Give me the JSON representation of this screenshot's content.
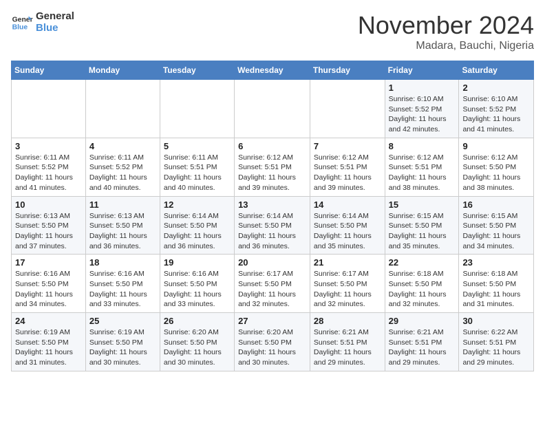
{
  "header": {
    "logo_line1": "General",
    "logo_line2": "Blue",
    "month": "November 2024",
    "location": "Madara, Bauchi, Nigeria"
  },
  "weekdays": [
    "Sunday",
    "Monday",
    "Tuesday",
    "Wednesday",
    "Thursday",
    "Friday",
    "Saturday"
  ],
  "weeks": [
    [
      {
        "day": "",
        "info": ""
      },
      {
        "day": "",
        "info": ""
      },
      {
        "day": "",
        "info": ""
      },
      {
        "day": "",
        "info": ""
      },
      {
        "day": "",
        "info": ""
      },
      {
        "day": "1",
        "info": "Sunrise: 6:10 AM\nSunset: 5:52 PM\nDaylight: 11 hours\nand 42 minutes."
      },
      {
        "day": "2",
        "info": "Sunrise: 6:10 AM\nSunset: 5:52 PM\nDaylight: 11 hours\nand 41 minutes."
      }
    ],
    [
      {
        "day": "3",
        "info": "Sunrise: 6:11 AM\nSunset: 5:52 PM\nDaylight: 11 hours\nand 41 minutes."
      },
      {
        "day": "4",
        "info": "Sunrise: 6:11 AM\nSunset: 5:52 PM\nDaylight: 11 hours\nand 40 minutes."
      },
      {
        "day": "5",
        "info": "Sunrise: 6:11 AM\nSunset: 5:51 PM\nDaylight: 11 hours\nand 40 minutes."
      },
      {
        "day": "6",
        "info": "Sunrise: 6:12 AM\nSunset: 5:51 PM\nDaylight: 11 hours\nand 39 minutes."
      },
      {
        "day": "7",
        "info": "Sunrise: 6:12 AM\nSunset: 5:51 PM\nDaylight: 11 hours\nand 39 minutes."
      },
      {
        "day": "8",
        "info": "Sunrise: 6:12 AM\nSunset: 5:51 PM\nDaylight: 11 hours\nand 38 minutes."
      },
      {
        "day": "9",
        "info": "Sunrise: 6:12 AM\nSunset: 5:50 PM\nDaylight: 11 hours\nand 38 minutes."
      }
    ],
    [
      {
        "day": "10",
        "info": "Sunrise: 6:13 AM\nSunset: 5:50 PM\nDaylight: 11 hours\nand 37 minutes."
      },
      {
        "day": "11",
        "info": "Sunrise: 6:13 AM\nSunset: 5:50 PM\nDaylight: 11 hours\nand 36 minutes."
      },
      {
        "day": "12",
        "info": "Sunrise: 6:14 AM\nSunset: 5:50 PM\nDaylight: 11 hours\nand 36 minutes."
      },
      {
        "day": "13",
        "info": "Sunrise: 6:14 AM\nSunset: 5:50 PM\nDaylight: 11 hours\nand 36 minutes."
      },
      {
        "day": "14",
        "info": "Sunrise: 6:14 AM\nSunset: 5:50 PM\nDaylight: 11 hours\nand 35 minutes."
      },
      {
        "day": "15",
        "info": "Sunrise: 6:15 AM\nSunset: 5:50 PM\nDaylight: 11 hours\nand 35 minutes."
      },
      {
        "day": "16",
        "info": "Sunrise: 6:15 AM\nSunset: 5:50 PM\nDaylight: 11 hours\nand 34 minutes."
      }
    ],
    [
      {
        "day": "17",
        "info": "Sunrise: 6:16 AM\nSunset: 5:50 PM\nDaylight: 11 hours\nand 34 minutes."
      },
      {
        "day": "18",
        "info": "Sunrise: 6:16 AM\nSunset: 5:50 PM\nDaylight: 11 hours\nand 33 minutes."
      },
      {
        "day": "19",
        "info": "Sunrise: 6:16 AM\nSunset: 5:50 PM\nDaylight: 11 hours\nand 33 minutes."
      },
      {
        "day": "20",
        "info": "Sunrise: 6:17 AM\nSunset: 5:50 PM\nDaylight: 11 hours\nand 32 minutes."
      },
      {
        "day": "21",
        "info": "Sunrise: 6:17 AM\nSunset: 5:50 PM\nDaylight: 11 hours\nand 32 minutes."
      },
      {
        "day": "22",
        "info": "Sunrise: 6:18 AM\nSunset: 5:50 PM\nDaylight: 11 hours\nand 32 minutes."
      },
      {
        "day": "23",
        "info": "Sunrise: 6:18 AM\nSunset: 5:50 PM\nDaylight: 11 hours\nand 31 minutes."
      }
    ],
    [
      {
        "day": "24",
        "info": "Sunrise: 6:19 AM\nSunset: 5:50 PM\nDaylight: 11 hours\nand 31 minutes."
      },
      {
        "day": "25",
        "info": "Sunrise: 6:19 AM\nSunset: 5:50 PM\nDaylight: 11 hours\nand 30 minutes."
      },
      {
        "day": "26",
        "info": "Sunrise: 6:20 AM\nSunset: 5:50 PM\nDaylight: 11 hours\nand 30 minutes."
      },
      {
        "day": "27",
        "info": "Sunrise: 6:20 AM\nSunset: 5:50 PM\nDaylight: 11 hours\nand 30 minutes."
      },
      {
        "day": "28",
        "info": "Sunrise: 6:21 AM\nSunset: 5:51 PM\nDaylight: 11 hours\nand 29 minutes."
      },
      {
        "day": "29",
        "info": "Sunrise: 6:21 AM\nSunset: 5:51 PM\nDaylight: 11 hours\nand 29 minutes."
      },
      {
        "day": "30",
        "info": "Sunrise: 6:22 AM\nSunset: 5:51 PM\nDaylight: 11 hours\nand 29 minutes."
      }
    ]
  ]
}
